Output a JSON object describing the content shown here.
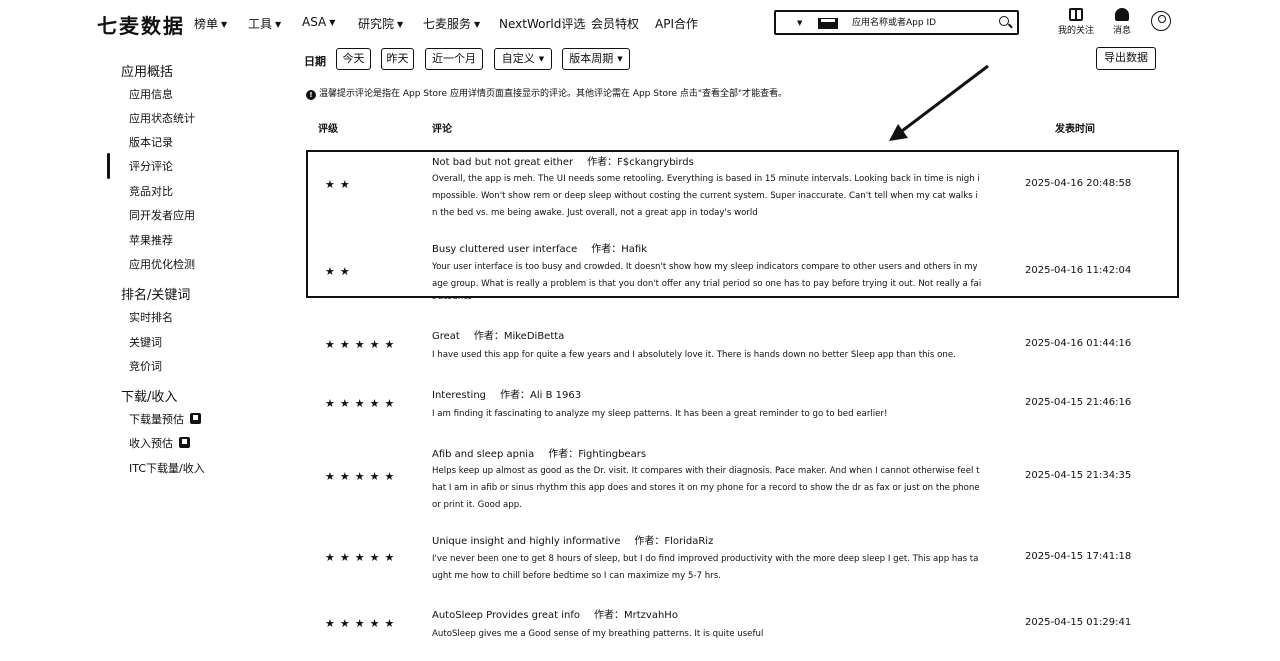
{
  "brand": "七麦数据",
  "nav": [
    {
      "label": "榜单",
      "caret": true
    },
    {
      "label": "工具",
      "caret": true
    },
    {
      "label": "ASA",
      "caret": true
    },
    {
      "label": "研究院",
      "caret": true
    },
    {
      "label": "七麦服务",
      "caret": true
    },
    {
      "label": "NextWorld评选",
      "caret": false
    },
    {
      "label": "会员特权",
      "caret": false
    },
    {
      "label": "API合作",
      "caret": false
    }
  ],
  "search": {
    "placeholder": "应用名称或者App ID",
    "platform_icon": "apple-icon"
  },
  "user": {
    "follow_label": "我的关注",
    "messages_label": "消息"
  },
  "sidebar": {
    "groups": [
      {
        "label": "应用概括",
        "items": [
          "应用信息",
          "应用状态统计",
          "版本记录",
          "评分评论",
          "竞品对比",
          "同开发者应用",
          "苹果推荐",
          "应用优化检测"
        ]
      },
      {
        "label": "排名/关键词",
        "items": [
          "实时排名",
          "关键词",
          "竞价词"
        ]
      },
      {
        "label": "下载/收入",
        "items": [
          "下载量预估",
          "收入预估",
          "ITC下载量/收入"
        ]
      }
    ],
    "active_item": "评分评论"
  },
  "filters": {
    "date_label": "日期",
    "buttons": [
      "今天",
      "昨天",
      "近一个月"
    ],
    "dropdowns": [
      "自定义",
      "版本周期"
    ],
    "export_label": "导出数据"
  },
  "notice": "温馨提示评论是指在 App Store 应用详情页面直接显示的评论。其他评论需在 App Store 点击\"查看全部\"才能查看。",
  "table": {
    "headers": {
      "rating": "评级",
      "review": "评论",
      "date": "发表时间"
    },
    "author_prefix": "作者：",
    "rows": [
      {
        "stars": 2,
        "title": "Not bad but not great either",
        "author": "F$ckangrybirds",
        "body": "Overall, the app is meh. The UI needs some retooling. Everything is based in 15 minute intervals. Looking back in time is nigh impossible. Won't show rem or deep sleep without costing the current system. Super inaccurate. Can't tell when my cat walks in the bed vs. me being awake. Just overall, not a great app in today's world",
        "date": "2025-04-16 20:48:58"
      },
      {
        "stars": 2,
        "title": "Busy cluttered user interface",
        "author": "Hafik",
        "body": "Your user interface is too busy and crowded. It doesn't show how my sleep indicators compare to other users and others in my age group. What is really a problem is that you don't offer any trial period so one has to pay before trying it out. Not really a fair product.",
        "date": "2025-04-16 11:42:04"
      },
      {
        "stars": 5,
        "title": "Great",
        "author": "MikeDiBetta",
        "body": "I have used this app for quite a few years and I absolutely love it. There is hands down no better Sleep app than this one.",
        "date": "2025-04-16 01:44:16"
      },
      {
        "stars": 5,
        "title": "Interesting",
        "author": "Ali B 1963",
        "body": "I am finding it fascinating to analyze my sleep patterns. It has been a great reminder to go to bed earlier!",
        "date": "2025-04-15 21:46:16"
      },
      {
        "stars": 5,
        "title": "Afib and sleep apnia",
        "author": "Fightingbears",
        "body": "Helps keep up almost as good as the Dr. visit. It compares with their diagnosis. Pace maker. And when I cannot otherwise feel that I am in afib or sinus rhythm this app does and stores it on my phone for a record to show the dr as fax or just on the phone or print it. Good app.",
        "date": "2025-04-15 21:34:35"
      },
      {
        "stars": 5,
        "title": "Unique insight and highly informative",
        "author": "FloridaRiz",
        "body": "I've never been one to get 8 hours of sleep, but I do find improved productivity with the more deep sleep I get. This app has taught me how to chill before bedtime so I can maximize my 5-7 hrs.",
        "date": "2025-04-15 17:41:18"
      },
      {
        "stars": 5,
        "title": "AutoSleep Provides great info",
        "author": "MrtzvahHo",
        "body": "AutoSleep gives me a Good sense of my breathing patterns. It is quite useful",
        "date": "2025-04-15 01:29:41"
      }
    ]
  }
}
